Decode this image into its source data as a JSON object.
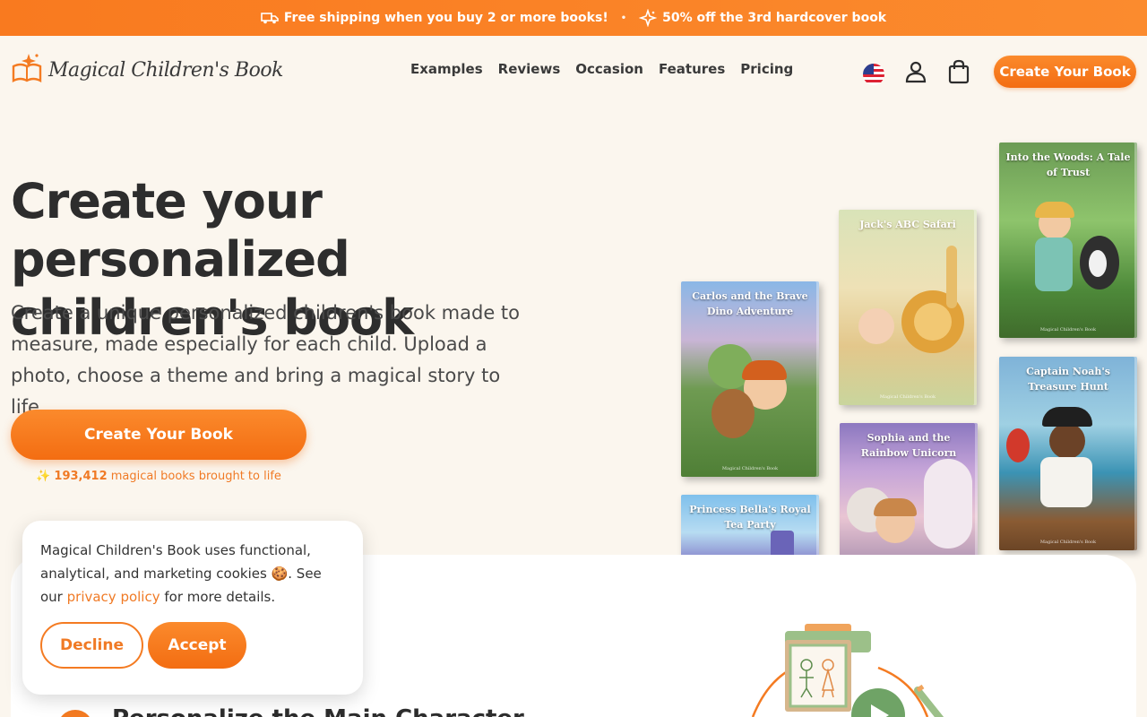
{
  "promo": {
    "item1": "Free shipping when you buy 2 or more books!",
    "separator": "•",
    "item2": "50% off the 3rd hardcover book",
    "icon1": "truck-icon",
    "icon2": "sparkle-icon"
  },
  "header": {
    "logo_text": "Magical Children's Book",
    "nav": [
      "Examples",
      "Reviews",
      "Occasion",
      "Features",
      "Pricing"
    ],
    "cta": "Create Your Book",
    "icons": [
      "us-flag-icon",
      "user-icon",
      "shopping-bag-icon"
    ]
  },
  "hero": {
    "title_line1": "Create your personalized",
    "title_line2": "children's book",
    "subtitle": "Create a unique personalized children's book made to measure, made especially for each child. Upload a photo, choose a theme and bring a magical story to life.",
    "cta": "Create Your Book",
    "counter_prefix": "✨",
    "counter_number": "193,412",
    "counter_suffix": "magical books brought to life"
  },
  "books": [
    {
      "title": "Carlos and the Brave Dino Adventure",
      "footer": "Magical Children's Book"
    },
    {
      "title": "Jack's ABC Safari",
      "footer": "Magical Children's Book"
    },
    {
      "title": "Into the Woods: A Tale of Trust",
      "footer": "Magical Children's Book"
    },
    {
      "title": "Sophia and the Rainbow Unicorn",
      "footer": ""
    },
    {
      "title": "Captain Noah's Treasure Hunt",
      "footer": "Magical Children's Book"
    },
    {
      "title": "Princess Bella's Royal Tea Party",
      "footer": ""
    }
  ],
  "section": {
    "heading": "Personalize the Main Character"
  },
  "cookie": {
    "text_before": "Magical Children's Book uses functional, analytical, and marketing cookies 🍪. See our ",
    "link": "privacy policy",
    "text_after": " for more details.",
    "decline": "Decline",
    "accept": "Accept"
  },
  "colors": {
    "accent": "#f47b22",
    "background": "#fbf6ee"
  }
}
